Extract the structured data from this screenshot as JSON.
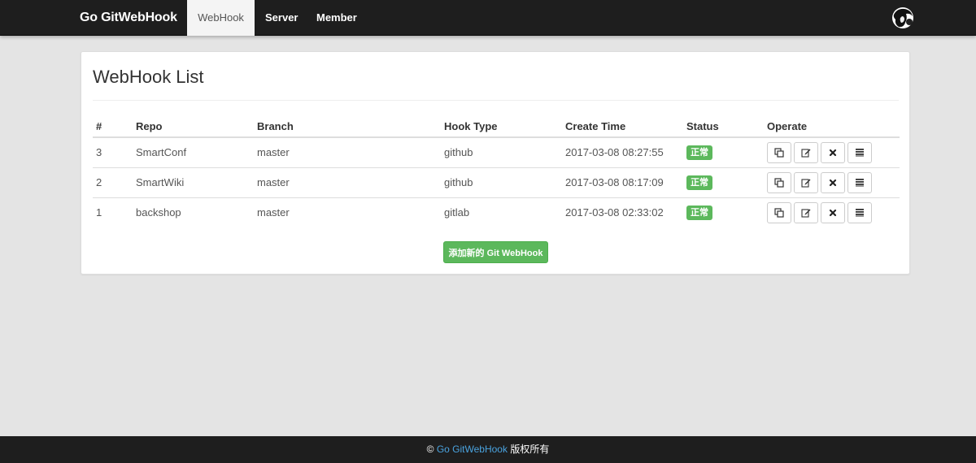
{
  "navbar": {
    "brand": "Go GitWebHook",
    "items": [
      {
        "label": "WebHook",
        "active": true
      },
      {
        "label": "Server",
        "active": false
      },
      {
        "label": "Member",
        "active": false
      }
    ]
  },
  "panel": {
    "title": "WebHook List"
  },
  "table": {
    "headers": [
      "#",
      "Repo",
      "Branch",
      "Hook Type",
      "Create Time",
      "Status",
      "Operate"
    ],
    "rows": [
      {
        "id": "3",
        "repo": "SmartConf",
        "branch": "master",
        "hook_type": "github",
        "create_time": "2017-03-08 08:27:55",
        "status": "正常"
      },
      {
        "id": "2",
        "repo": "SmartWiki",
        "branch": "master",
        "hook_type": "github",
        "create_time": "2017-03-08 08:17:09",
        "status": "正常"
      },
      {
        "id": "1",
        "repo": "backshop",
        "branch": "master",
        "hook_type": "gitlab",
        "create_time": "2017-03-08 02:33:02",
        "status": "正常"
      }
    ],
    "operate_icons": [
      "copy-icon",
      "edit-icon",
      "delete-icon",
      "list-icon"
    ]
  },
  "add_button": {
    "label": "添加新的 Git WebHook"
  },
  "footer": {
    "copyright_symbol": "©",
    "link_text": "Go GitWebHook",
    "suffix": "版权所有"
  },
  "colors": {
    "navbar_bg": "#1e1e1e",
    "success_green": "#5cb85c",
    "footer_link": "#4aa3df",
    "page_bg": "#e4e4e4"
  }
}
